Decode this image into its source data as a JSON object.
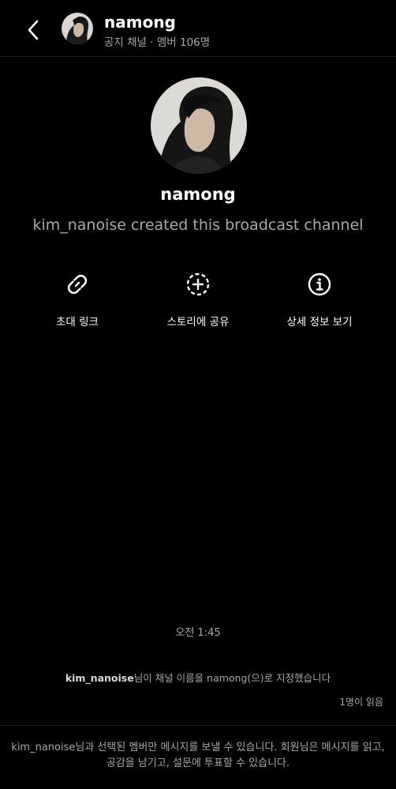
{
  "header": {
    "back_icon": "chevron-left-icon",
    "title": "namong",
    "subtitle": "공지 채널 · 멤버 106명"
  },
  "channel": {
    "name": "namong",
    "created_text": "kim_nanoise created this broadcast channel"
  },
  "actions": [
    {
      "icon": "link-icon",
      "label": "초대 링크"
    },
    {
      "icon": "add-story-icon",
      "label": "스토리에 공유"
    },
    {
      "icon": "info-icon",
      "label": "상세 정보 보기"
    }
  ],
  "messages": {
    "timestamp": "오전 1:45",
    "system_user": "kim_nanoise",
    "system_text": "님이 채널 이름을 namong(으)로 지정했습니다",
    "read_receipt": "1명이 읽음"
  },
  "footer": {
    "notice": "kim_nanoise님과 선택된 멤버만 메시지를 보낼 수 있습니다. 회원님은 메시지를 읽고, 공감을 남기고, 설문에 투표할 수 있습니다."
  }
}
